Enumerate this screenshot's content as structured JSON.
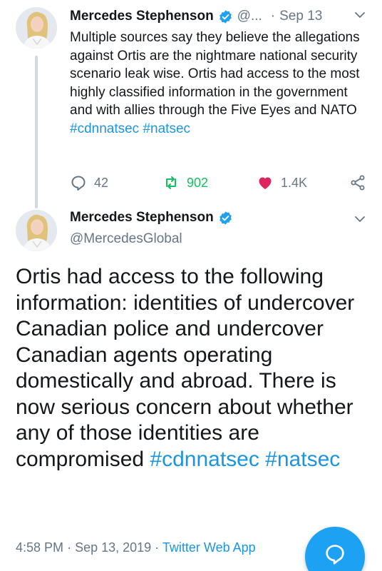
{
  "tweet1": {
    "author_name": "Mercedes Stephenson",
    "handle": "@...",
    "dot": "·",
    "date": "Sep 13",
    "text": "Multiple sources say they believe the allegations against Ortis are the nightmare national security scenario leak wise. Ortis had access to the most highly classified information in the government and with allies through the Five Eyes and NATO",
    "hashtags": "#cdnnatsec #natsec",
    "actions": {
      "reply_count": "42",
      "retweet_count": "902",
      "like_count": "1.4K"
    },
    "icons": [
      "verified-badge-icon",
      "chevron-down-icon",
      "reply-icon",
      "retweet-icon",
      "heart-icon",
      "share-icon"
    ]
  },
  "tweet2": {
    "author_name": "Mercedes Stephenson",
    "handle": "@MercedesGlobal",
    "text": "Ortis had access to the following information: identities of undercover Canadian police and undercover Canadian agents operating domestically and abroad. There is now serious concern about whether any of those identities are compromised",
    "hashtags": "#cdnnatsec #natsec",
    "time": "4:58 PM",
    "sep1": "·",
    "date": "Sep 13, 2019",
    "sep2": "·",
    "source": "Twitter Web App"
  },
  "compose_fab": {
    "icon": "compose-reply-icon"
  },
  "colors": {
    "link": "#1b95e0",
    "secondary_text": "#657786",
    "retweet_green": "#17bf63",
    "like_red": "#e0245e",
    "fab_blue": "#1da1f2"
  }
}
